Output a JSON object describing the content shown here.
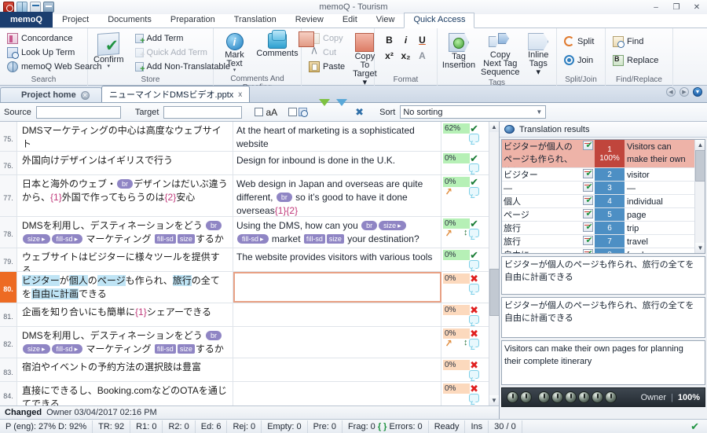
{
  "window": {
    "title": "memoQ - Tourism",
    "quick_access_icons": [
      "memoq-logo-icon",
      "globe-icon",
      "key-icon",
      "database-icon"
    ],
    "controls": {
      "minimize": "–",
      "maximize": "❐",
      "close": "✕"
    }
  },
  "ribbon": {
    "tabs": [
      {
        "label": "memoQ",
        "style": "first"
      },
      {
        "label": "Project"
      },
      {
        "label": "Documents"
      },
      {
        "label": "Preparation"
      },
      {
        "label": "Translation"
      },
      {
        "label": "Review"
      },
      {
        "label": "Edit"
      },
      {
        "label": "View"
      },
      {
        "label": "Quick Access",
        "active": true
      }
    ],
    "groups": [
      {
        "label": "Search",
        "items": [
          {
            "label": "Concordance",
            "icon": "concordance-icon",
            "disabled": false
          },
          {
            "label": "Look Up Term",
            "icon": "lookup-term-icon",
            "disabled": false
          },
          {
            "label": "memoQ Web Search",
            "icon": "web-search-icon",
            "disabled": false
          }
        ]
      },
      {
        "label": "Store",
        "big": {
          "label": "Confirm",
          "icon": "confirm-icon",
          "arrow": "▾"
        },
        "items": [
          {
            "label": "Add Term",
            "icon": "add-term-icon",
            "disabled": false
          },
          {
            "label": "Quick Add Term",
            "icon": "quick-add-term-icon",
            "disabled": true
          },
          {
            "label": "Add Non-Translatable",
            "icon": "add-non-translatable-icon",
            "disabled": false
          }
        ]
      },
      {
        "label": "Comments And Proofing",
        "big_items": [
          {
            "label": "Mark Text",
            "icon": "mark-text-icon",
            "arrow": "▾"
          },
          {
            "label": "Comments",
            "icon": "comments-icon"
          }
        ]
      },
      {
        "label": "Clipboard",
        "items": [
          {
            "label": "Copy",
            "icon": "copy-icon",
            "disabled": true
          },
          {
            "label": "Cut",
            "icon": "cut-icon",
            "disabled": true
          },
          {
            "label": "Paste",
            "icon": "paste-icon",
            "disabled": false
          }
        ],
        "big": {
          "label": "Copy To Target ▾",
          "icon": "copy-to-target-icon"
        }
      },
      {
        "label": "Format",
        "format_row1": [
          {
            "label": "B",
            "name": "bold-button"
          },
          {
            "label": "i",
            "name": "italic-button"
          },
          {
            "label": "U",
            "name": "underline-button"
          }
        ],
        "format_row2": [
          {
            "label": "x²",
            "name": "superscript-button"
          },
          {
            "label": "x₂",
            "name": "subscript-button"
          },
          {
            "label": "A",
            "name": "clear-formatting-button"
          }
        ]
      },
      {
        "label": "Tags",
        "big_items": [
          {
            "label": "Tag Insertion",
            "icon": "tag-insertion-icon"
          },
          {
            "label": "Copy Next Tag Sequence",
            "icon": "copy-next-tag-sequence-icon"
          },
          {
            "label": "Inline Tags ▾",
            "icon": "inline-tags-icon"
          }
        ]
      },
      {
        "label": "Split/Join",
        "items": [
          {
            "label": "Split",
            "icon": "split-icon"
          },
          {
            "label": "Join",
            "icon": "join-icon"
          }
        ]
      },
      {
        "label": "Find/Replace",
        "items": [
          {
            "label": "Find",
            "icon": "find-icon"
          },
          {
            "label": "Replace",
            "icon": "replace-icon"
          }
        ]
      }
    ]
  },
  "doctabs": {
    "home": "Project home",
    "open": "ニューマインドDMSビデオ.pptx",
    "close_glyph": "x",
    "nav": [
      "prev-arrow-icon",
      "next-arrow-icon",
      "dropdown-arrow-icon"
    ]
  },
  "filterbar": {
    "source_label": "Source",
    "source_value": "",
    "source_placeholder": "",
    "target_label": "Target",
    "target_value": "",
    "target_placeholder": "",
    "case_icon_label": "aA",
    "sort_label": "Sort",
    "sort_value": "No sorting",
    "sort_options": [
      "No sorting"
    ]
  },
  "grid": {
    "rows": [
      {
        "num": "75.",
        "source_parts": [
          {
            "t": "DMSマーケティングの中心は高度なウェブサイト",
            "k": "text"
          }
        ],
        "target_parts": [
          {
            "t": "At the heart of marketing is a sophisticated website",
            "k": "text"
          }
        ],
        "pct": "62%",
        "pct_color": "green",
        "status": "ok",
        "has_zig": false,
        "has_arrow": false,
        "height": 40
      },
      {
        "num": "76.",
        "source_parts": [
          {
            "t": "外国向けデザインはイギリスで行う",
            "k": "text"
          }
        ],
        "target_parts": [
          {
            "t": "Design for inbound is done in the U.K.",
            "k": "text"
          }
        ],
        "pct": "0%",
        "pct_color": "green",
        "status": "ok",
        "has_zig": false,
        "has_arrow": false,
        "height": 29
      },
      {
        "num": "77.",
        "source_parts": [
          {
            "t": "日本と海外のウェブ・",
            "k": "text"
          },
          {
            "t": "br",
            "k": "tag-round"
          },
          {
            "t": "デザインはだいぶ違うから、",
            "k": "text"
          },
          {
            "t": "{1}",
            "k": "ph"
          },
          {
            "t": "外国で作ってもらうのは",
            "k": "text"
          },
          {
            "t": "{2}",
            "k": "ph"
          },
          {
            "t": "安心",
            "k": "text"
          }
        ],
        "target_parts": [
          {
            "t": "Web design in Japan and overseas are quite different, ",
            "k": "text"
          },
          {
            "t": "br",
            "k": "tag-round"
          },
          {
            "t": " so it’s good to have it done overseas",
            "k": "text"
          },
          {
            "t": "{1}{2}",
            "k": "ph"
          }
        ],
        "pct": "0%",
        "pct_color": "green",
        "status": "ok",
        "has_zig": true,
        "has_arrow": false,
        "height": 55
      },
      {
        "num": "78.",
        "source_parts": [
          {
            "t": "DMSを利用し、デスティネーションをどう ",
            "k": "text"
          },
          {
            "t": "br",
            "k": "tag-round"
          },
          {
            "t": "size",
            "k": "tag-arrow"
          },
          {
            "t": "fill-sd",
            "k": "tag-arrow"
          },
          {
            "t": " マーケティング ",
            "k": "text"
          },
          {
            "t": "fill-sd",
            "k": "tag"
          },
          {
            "t": "size",
            "k": "tag"
          },
          {
            "t": "するか",
            "k": "text"
          }
        ],
        "target_parts": [
          {
            "t": "Using the DMS, how can you ",
            "k": "text"
          },
          {
            "t": "br",
            "k": "tag-round"
          },
          {
            "t": "size",
            "k": "tag-arrow"
          },
          {
            "t": "fill-sd",
            "k": "tag-arrow"
          },
          {
            "t": " market ",
            "k": "text"
          },
          {
            "t": "fill-sd",
            "k": "tag"
          },
          {
            "t": "size",
            "k": "tag"
          },
          {
            "t": " your destination?",
            "k": "text"
          }
        ],
        "pct": "0%",
        "pct_color": "green",
        "status": "ok",
        "has_zig": true,
        "has_arrow": true,
        "height": 42
      },
      {
        "num": "79.",
        "source_parts": [
          {
            "t": "ウェブサイトはビジターに様々ツールを提供する",
            "k": "text"
          }
        ],
        "target_parts": [
          {
            "t": "The website provides visitors with various tools",
            "k": "text"
          }
        ],
        "pct": "0%",
        "pct_color": "green",
        "status": "ok",
        "has_zig": false,
        "has_arrow": false,
        "height": 27
      },
      {
        "num": "80.",
        "selected": true,
        "source_parts": [
          {
            "t": "ビジター",
            "k": "hl"
          },
          {
            "t": "が",
            "k": "text"
          },
          {
            "t": "個人",
            "k": "hl"
          },
          {
            "t": "の",
            "k": "text"
          },
          {
            "t": "ページ",
            "k": "hl"
          },
          {
            "t": "も作られ、",
            "k": "text"
          },
          {
            "t": "旅行",
            "k": "hl"
          },
          {
            "t": "の全てを",
            "k": "text"
          },
          {
            "t": "自由に計画",
            "k": "hl"
          },
          {
            "t": "できる",
            "k": "text"
          }
        ],
        "target_parts": [],
        "pct": "0%",
        "pct_color": "orange",
        "status": "no",
        "has_zig": false,
        "has_arrow": false,
        "height": 42
      },
      {
        "num": "81.",
        "source_parts": [
          {
            "t": "企画を知り合いにも簡単に",
            "k": "text"
          },
          {
            "t": "{1}",
            "k": "ph"
          },
          {
            "t": "シェアーできる",
            "k": "text"
          }
        ],
        "target_parts": [],
        "pct": "0%",
        "pct_color": "orange",
        "status": "no",
        "has_zig": false,
        "has_arrow": false,
        "height": 29
      },
      {
        "num": "82.",
        "source_parts": [
          {
            "t": "DMSを利用し、デスティネーションをどう ",
            "k": "text"
          },
          {
            "t": "br",
            "k": "tag-round"
          },
          {
            "t": "size",
            "k": "tag-arrow"
          },
          {
            "t": "fill-sd",
            "k": "tag-arrow"
          },
          {
            "t": " マーケティング ",
            "k": "text"
          },
          {
            "t": "fill-sd",
            "k": "tag"
          },
          {
            "t": "size",
            "k": "tag"
          },
          {
            "t": "するか",
            "k": "text"
          }
        ],
        "target_parts": [],
        "pct": "0%",
        "pct_color": "orange",
        "status": "no",
        "has_zig": true,
        "has_arrow": true,
        "height": 42
      },
      {
        "num": "83.",
        "source_parts": [
          {
            "t": "宿泊やイベントの予約方法の選択肢は豊富",
            "k": "text"
          }
        ],
        "target_parts": [],
        "pct": "0%",
        "pct_color": "orange",
        "status": "no",
        "has_zig": false,
        "has_arrow": false,
        "height": 29
      },
      {
        "num": "84.",
        "source_parts": [
          {
            "t": "直接にできるし、Booking.comなどのOTAを通じてできる",
            "k": "text"
          }
        ],
        "target_parts": [],
        "pct": "0%",
        "pct_color": "orange",
        "status": "no",
        "has_zig": false,
        "has_arrow": false,
        "height": 26,
        "partial": true
      }
    ]
  },
  "right_panel": {
    "title": "Translation results",
    "results": [
      {
        "rank": "1",
        "score": "100%",
        "source": "ビジターが個人のページも作られ、旅行 ...",
        "target": "Visitors can make their own pages ...",
        "top": true
      },
      {
        "rank": "2",
        "score": "",
        "source": "ビジター",
        "target": "visitor"
      },
      {
        "rank": "3",
        "score": "",
        "source": "—",
        "target": "—"
      },
      {
        "rank": "4",
        "score": "",
        "source": "個人",
        "target": "individual"
      },
      {
        "rank": "5",
        "score": "",
        "source": "ページ",
        "target": "page"
      },
      {
        "rank": "6",
        "score": "",
        "source": "旅行",
        "target": "trip"
      },
      {
        "rank": "7",
        "score": "",
        "source": "旅行",
        "target": "travel"
      },
      {
        "rank": "8",
        "score": "",
        "source": "自由に",
        "target": "freely"
      }
    ],
    "preview_boxes": [
      {
        "text": "ビジターが個人のページも作られ、旅行の全てを自由に計画できる"
      },
      {
        "text": "ビジターが個人のページも作られ、旅行の全てを自由に計画できる"
      },
      {
        "text": "Visitors can make their own pages for planning their complete itinerary"
      }
    ],
    "footer": {
      "owner": "Owner",
      "separator": "|",
      "percent": "100%",
      "knob_count": 8
    }
  },
  "changed_bar": {
    "label": "Changed",
    "value": "Owner 03/04/2017 02:16 PM"
  },
  "statusbar": {
    "cells": [
      "P (eng): 27%  D: 92%",
      "TR: 92",
      "R1: 0",
      "R2: 0",
      "Ed: 6",
      "Rej: 0",
      "Empty: 0",
      "Pre: 0",
      "Frag: 0",
      "Errors: 0",
      "Ready",
      "Ins",
      "30 / 0"
    ],
    "braces_glyph": "{ }",
    "right_check": "✔"
  }
}
